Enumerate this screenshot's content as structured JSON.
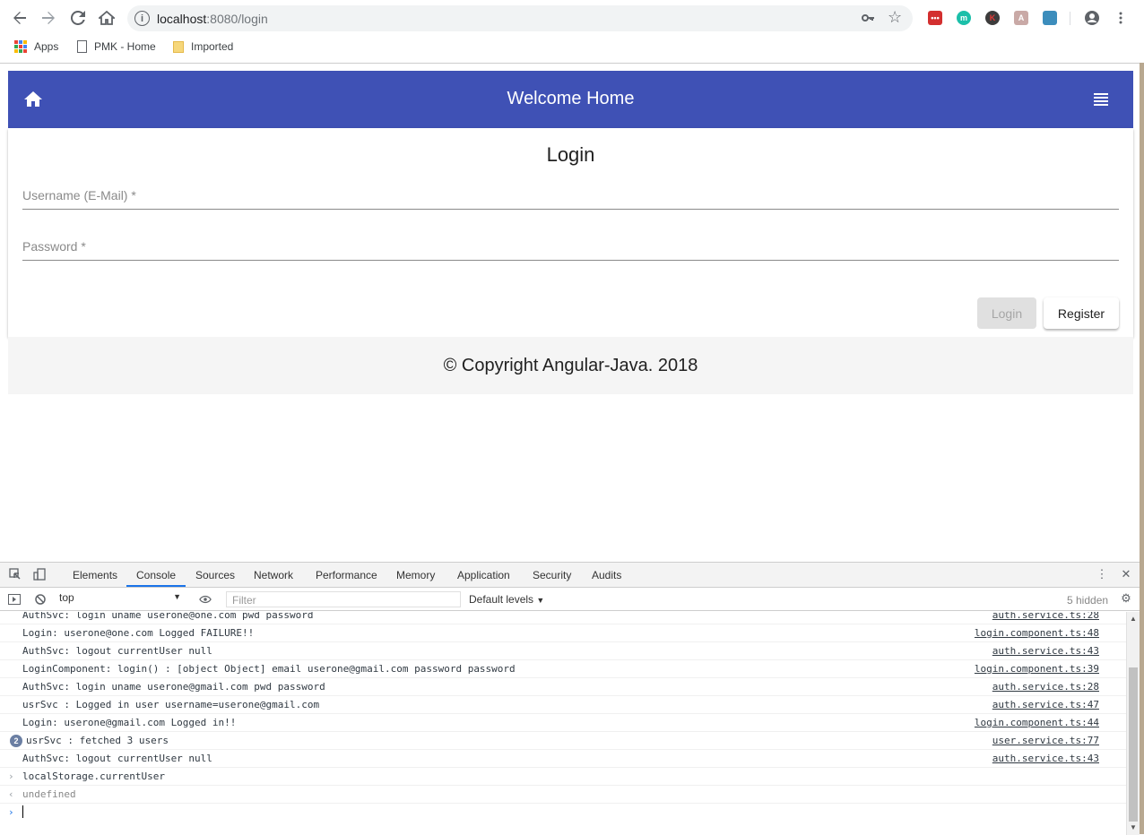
{
  "browser": {
    "url_host": "localhost",
    "url_rest": ":8080/login",
    "bookmarks": [
      {
        "label": "Apps",
        "icon": "apps-grid-icon"
      },
      {
        "label": "PMK - Home",
        "icon": "page-icon"
      },
      {
        "label": "Imported",
        "icon": "folder-icon"
      }
    ]
  },
  "page": {
    "header_title": "Welcome Home",
    "login_title": "Login",
    "username_label": "Username (E-Mail) *",
    "password_label": "Password *",
    "login_button": "Login",
    "register_button": "Register",
    "footer_text": "© Copyright Angular-Java. 2018",
    "header_color": "#3f51b5"
  },
  "devtools": {
    "tabs": [
      "Elements",
      "Console",
      "Sources",
      "Network",
      "Performance",
      "Memory",
      "Application",
      "Security",
      "Audits"
    ],
    "active_tab": "Console",
    "context": "top",
    "filter_placeholder": "Filter",
    "levels": "Default levels",
    "hidden": "5 hidden",
    "rows": [
      {
        "msg": "AuthSvc: login uname userone@one.com pwd password",
        "src": "auth.service.ts:28"
      },
      {
        "msg": "Login: userone@one.com Logged FAILURE!!",
        "src": "login.component.ts:48"
      },
      {
        "msg": "AuthSvc: logout currentUser null",
        "src": "auth.service.ts:43"
      },
      {
        "msg": "LoginComponent: login() : [object Object] email userone@gmail.com password password",
        "src": "login.component.ts:39"
      },
      {
        "msg": "AuthSvc: login uname userone@gmail.com pwd password",
        "src": "auth.service.ts:28"
      },
      {
        "msg": "usrSvc : Logged in user username=userone@gmail.com",
        "src": "auth.service.ts:47"
      },
      {
        "msg": "Login: userone@gmail.com Logged in!!",
        "src": "login.component.ts:44"
      },
      {
        "msg": "usrSvc : fetched 3 users",
        "src": "user.service.ts:77",
        "count": "2"
      },
      {
        "msg": "AuthSvc: logout currentUser null",
        "src": "auth.service.ts:43"
      }
    ],
    "input_line": "localStorage.currentUser",
    "result_line": "undefined"
  }
}
